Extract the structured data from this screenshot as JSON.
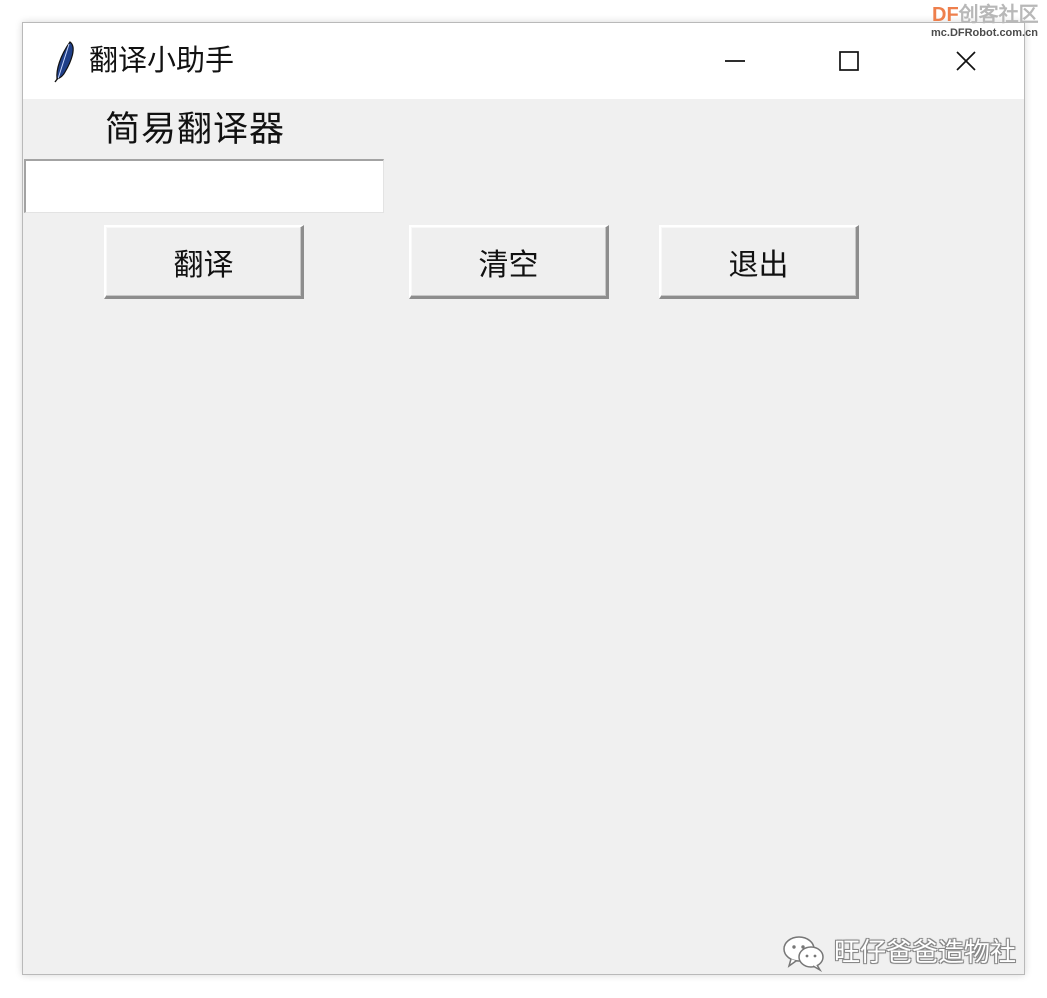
{
  "window": {
    "title": "翻译小助手",
    "icon": "feather-icon",
    "controls": {
      "minimize_icon": "minimize-icon",
      "maximize_icon": "maximize-icon",
      "close_icon": "close-icon"
    }
  },
  "app": {
    "label": "简易翻译器",
    "input": {
      "value": "",
      "placeholder": ""
    },
    "buttons": {
      "translate": "翻译",
      "clear": "清空",
      "exit": "退出"
    }
  },
  "watermarks": {
    "top_brand_latin": "DF",
    "top_brand_cn": "创客社区",
    "top_url": "mc.DFRobot.com.cn",
    "bottom_text": "旺仔爸爸造物社",
    "bottom_icon": "wechat-icon"
  },
  "colors": {
    "window_bg": "#f0f0f0",
    "titlebar_bg": "#ffffff",
    "button_face": "#efefef",
    "watermark_orange": "#ee7f4c"
  }
}
